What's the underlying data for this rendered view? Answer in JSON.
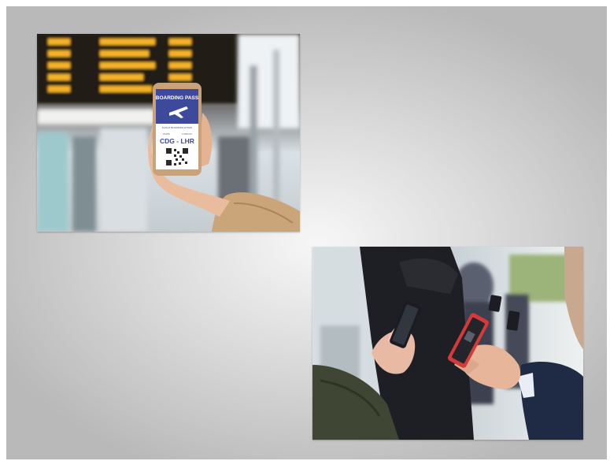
{
  "slide": {
    "photos": [
      {
        "name": "boarding-pass-phone-photo",
        "phone_screen": {
          "header": "BOARDING PASS",
          "subtitle": "FLIGHT BOARDING ETSAN",
          "from_city": "PARIS",
          "to_city": "LONDON",
          "route": "CDG - LHR"
        }
      },
      {
        "name": "travelers-using-phones-photo"
      }
    ]
  },
  "colors": {
    "pass_header": "#3d4a9c",
    "board_lights": "#f5b32b",
    "coat_tan": "#caa57a",
    "coat_green": "#3f4633",
    "suit_navy": "#1f2a44",
    "phone_red": "#d43a3a"
  }
}
